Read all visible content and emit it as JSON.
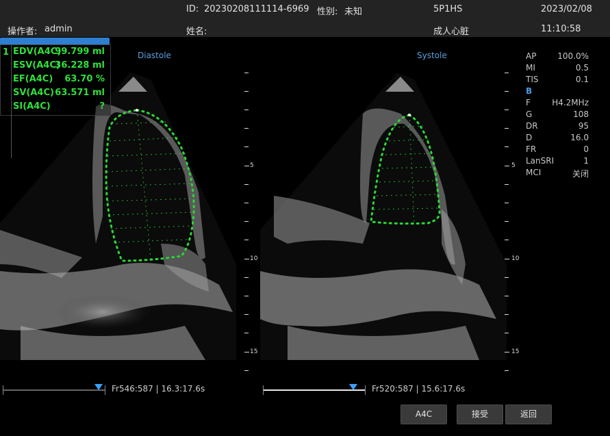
{
  "header": {
    "id_label": "ID:",
    "id_value": "20230208111114-6969",
    "sex_label": "性别:",
    "sex_value": "未知",
    "probe": "5P1HS",
    "date": "2023/02/08",
    "operator_label": "操作者:",
    "operator_value": "admin",
    "name_label": "姓名:",
    "exam_type": "成人心脏",
    "time": "11:10:58"
  },
  "measurements": {
    "index": "1",
    "rows": [
      {
        "label": "EDV(A4C)",
        "value": "99.799 ml"
      },
      {
        "label": "ESV(A4C)",
        "value": "36.228 ml"
      },
      {
        "label": "EF(A4C)",
        "value": "63.70 %"
      },
      {
        "label": "SV(A4C)",
        "value": "63.571 ml"
      },
      {
        "label": "SI(A4C)",
        "value": "?"
      }
    ],
    "accent_color": "#2fe03a"
  },
  "images": {
    "left_title": "Diastole",
    "right_title": "Systole",
    "depth_labels": [
      "5",
      "10",
      "15"
    ]
  },
  "params": {
    "rows": [
      {
        "key": "AP",
        "value": "100.0%"
      },
      {
        "key": "MI",
        "value": "0.5"
      },
      {
        "key": "TIS",
        "value": "0.1"
      }
    ],
    "mode": "B",
    "mode_rows": [
      {
        "key": "F",
        "value": "H4.2MHz"
      },
      {
        "key": "G",
        "value": "108"
      },
      {
        "key": "DR",
        "value": "95"
      },
      {
        "key": "D",
        "value": "16.0"
      },
      {
        "key": "FR",
        "value": "0"
      },
      {
        "key": "LanSRI",
        "value": "1"
      },
      {
        "key": "MCI",
        "value": "关闭"
      }
    ]
  },
  "cine": {
    "left_frame": "Fr546:587 | 16.3:17.6s",
    "right_frame": "Fr520:587 | 15.6:17.6s"
  },
  "buttons": {
    "a4c": "A4C",
    "accept": "接受",
    "back": "返回"
  }
}
